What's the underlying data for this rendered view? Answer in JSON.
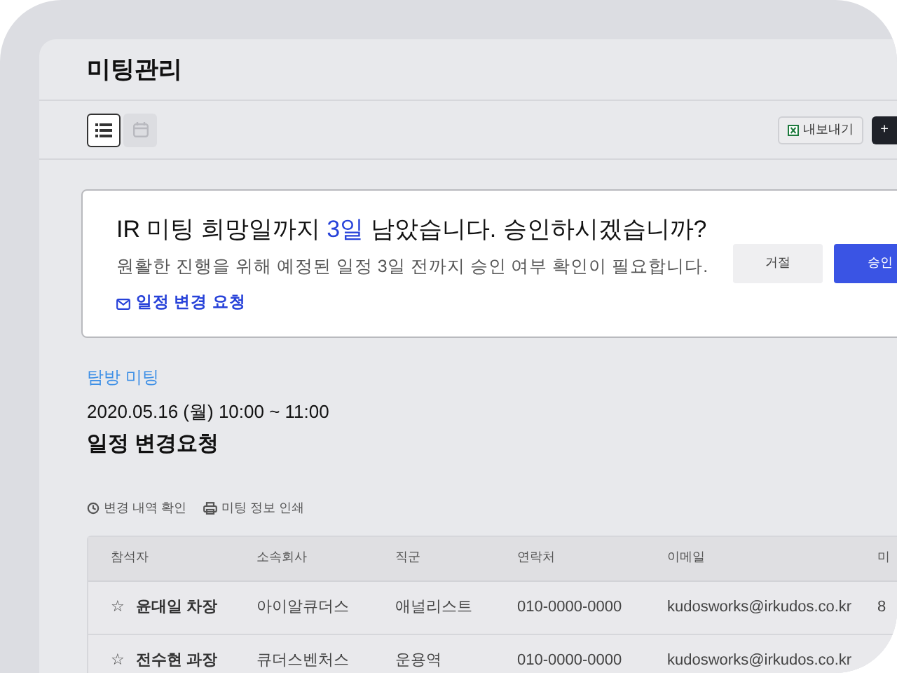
{
  "page": {
    "title": "미팅관리"
  },
  "toolbar": {
    "views": [
      {
        "kind": "list",
        "selected": true
      },
      {
        "kind": "calendar",
        "selected": false
      }
    ],
    "export_label": "내보내기",
    "add_label": "+"
  },
  "notice": {
    "title_before": "IR 미팅 희망일까지 ",
    "title_highlight": "3일",
    "title_after": " 남았습니다. 승인하시겠습니까?",
    "message": "원활한 진행을 위해 예정된 일정 3일 전까지 승인 여부 확인이 필요합니다.",
    "link": "일정 변경 요청",
    "buttons": [
      {
        "label": "거절",
        "kind": "secondary"
      },
      {
        "label": "승인",
        "kind": "primary"
      }
    ]
  },
  "meeting": {
    "category": "탐방 미팅",
    "datetime": "2020.05.16 (월) 10:00 ~ 11:00",
    "title": "일정 변경요청",
    "actions": [
      {
        "label": "변경 내역 확인",
        "kind": "history"
      },
      {
        "label": "미팅 정보 인쇄",
        "kind": "print"
      }
    ]
  },
  "table": {
    "columns": [
      "참석자",
      "소속회사",
      "직군",
      "연락처",
      "이메일",
      "미"
    ],
    "rows": [
      {
        "star": "☆",
        "name": "윤대일 차장",
        "company": "아이알큐더스",
        "role": "애널리스트",
        "phone": "010-0000-0000",
        "email": "kudosworks@irkudos.co.kr",
        "column_6": "8"
      },
      {
        "star": "☆",
        "name": "전수현 과장",
        "company": "큐더스벤처스",
        "role": "운용역",
        "phone": "010-0000-0000",
        "email": "kudosworks@irkudos.co.kr"
      }
    ]
  }
}
